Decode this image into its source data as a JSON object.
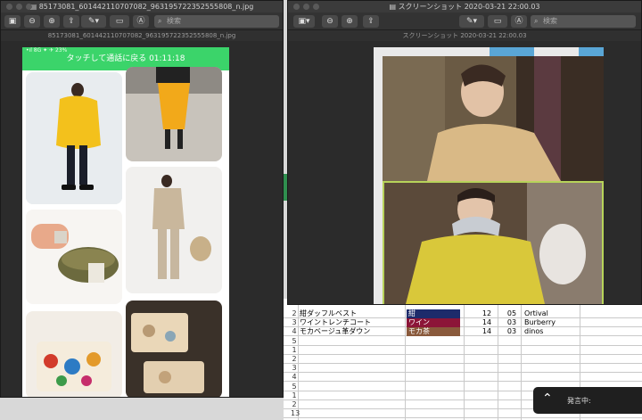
{
  "left_window": {
    "title": "85173081_601442110707082_963195722352555808_n.jpg",
    "subtitle": "85173081_601442110707082_963195722352555808_n.jpg",
    "search_placeholder": "検索",
    "phone": {
      "status": "•ıl 8G ✦   ✈   23%",
      "call_banner": "タッチして通話に戻る 01:11:18"
    }
  },
  "right_window": {
    "title": "スクリーンショット 2020-03-21 22:00.03",
    "subtitle": "スクリーンショット 2020-03-21 22:00.03",
    "search_placeholder": "検索"
  },
  "spreadsheet": {
    "rows": [
      {
        "num": "2",
        "item": "紺ダッフルベスト",
        "color": "紺",
        "color_hex": "#1d2b6b",
        "size": "12",
        "qty": "05",
        "brand": "Ortival"
      },
      {
        "num": "3",
        "item": "ワイントレンチコート",
        "color": "ワイン",
        "color_hex": "#8c1538",
        "size": "14",
        "qty": "03",
        "brand": "Burberry"
      },
      {
        "num": "4",
        "item": "モカベージュ革ダウン",
        "color": "モカ茶",
        "color_hex": "#8a5a3c",
        "size": "14",
        "qty": "03",
        "brand": "dinos"
      },
      {
        "num": "5",
        "item": "",
        "color": "",
        "color_hex": "",
        "size": "",
        "qty": "",
        "brand": ""
      },
      {
        "num": "1",
        "item": "",
        "color": "",
        "color_hex": "",
        "size": "",
        "qty": "",
        "brand": ""
      },
      {
        "num": "2",
        "item": "",
        "color": "",
        "color_hex": "",
        "size": "",
        "qty": "",
        "brand": ""
      },
      {
        "num": "3",
        "item": "",
        "color": "",
        "color_hex": "",
        "size": "",
        "qty": "",
        "brand": ""
      },
      {
        "num": "4",
        "item": "",
        "color": "",
        "color_hex": "",
        "size": "",
        "qty": "",
        "brand": ""
      },
      {
        "num": "5",
        "item": "",
        "color": "",
        "color_hex": "",
        "size": "",
        "qty": "",
        "brand": ""
      },
      {
        "num": "1",
        "item": "",
        "color": "",
        "color_hex": "",
        "size": "",
        "qty": "",
        "brand": ""
      },
      {
        "num": "2",
        "item": "",
        "color": "",
        "color_hex": "",
        "size": "",
        "qty": "",
        "brand": ""
      },
      {
        "num": "13",
        "item": "",
        "color": "",
        "color_hex": "",
        "size": "",
        "qty": "",
        "brand": ""
      }
    ]
  },
  "toast": {
    "label": "発言中:"
  }
}
